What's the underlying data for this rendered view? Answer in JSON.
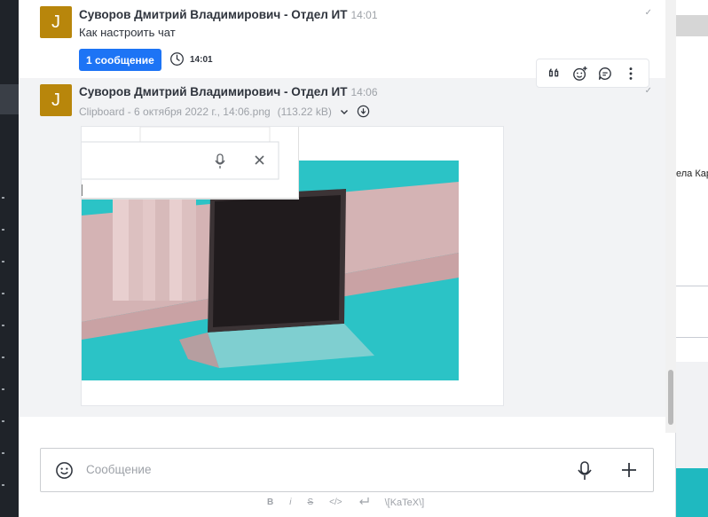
{
  "messages": [
    {
      "avatar_letter": "J",
      "author": "Суворов Дмитрий Владимирович - Отдел ИТ",
      "time": "14:01",
      "text": "Как настроить чат",
      "thread_button": "1 сообщение",
      "thread_time": "14:01"
    },
    {
      "avatar_letter": "J",
      "author": "Суворов Дмитрий Владимирович - Отдел ИТ",
      "time": "14:06",
      "file_name": "Clipboard - 6 октября 2022 г., 14:06.png",
      "file_size": "(113.22 kB)"
    }
  ],
  "read_mark": "✓",
  "composer": {
    "placeholder": "Сообщение"
  },
  "formatting": {
    "bold": "B",
    "italic": "i",
    "strike": "S",
    "code": "</>",
    "katex": "\\[KaTeX\\]"
  },
  "background_app": {
    "fragment": "ела Кар"
  },
  "colors": {
    "accent": "#1d74f5",
    "avatar": "#b8860b",
    "teal": "#1fb9c0"
  }
}
